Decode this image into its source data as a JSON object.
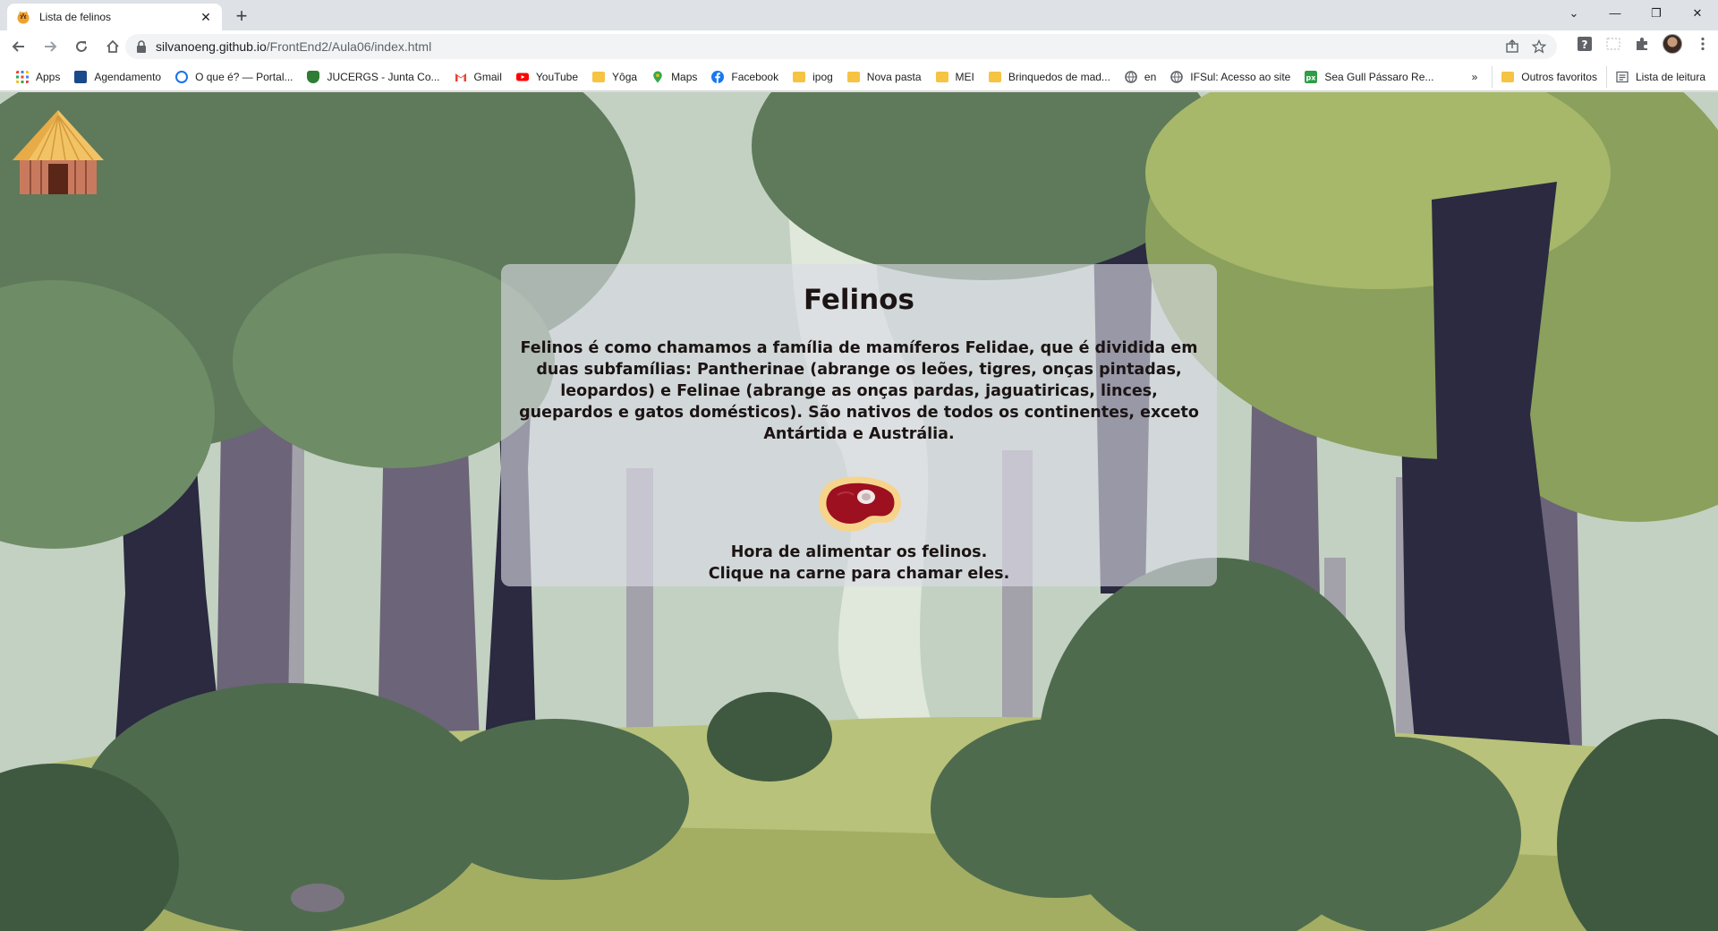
{
  "browser": {
    "tab_title": "Lista de felinos",
    "tab_close": "✕",
    "new_tab": "+",
    "url_host": "silvanoeng.github.io",
    "url_path": "/FrontEnd2/Aula06/index.html",
    "window_controls": [
      "⌄",
      "—",
      "❐",
      "✕"
    ]
  },
  "bookmarks": [
    {
      "label": "Apps",
      "icon": "apps-grid-icon",
      "color": "#ea4335"
    },
    {
      "label": "Agendamento",
      "icon": "agendamento-icon",
      "color": "#1a4a8a"
    },
    {
      "label": "O que é? — Portal...",
      "icon": "portal-icon",
      "color": "#1a73e8"
    },
    {
      "label": "JUCERGS - Junta Co...",
      "icon": "jucergs-icon",
      "color": "#2e7d32"
    },
    {
      "label": "Gmail",
      "icon": "gmail-icon",
      "color": "#ea4335"
    },
    {
      "label": "YouTube",
      "icon": "youtube-icon",
      "color": "#ff0000"
    },
    {
      "label": "Yôga",
      "icon": "folder-icon",
      "color": "#f6c342"
    },
    {
      "label": "Maps",
      "icon": "maps-icon",
      "color": "#34a853"
    },
    {
      "label": "Facebook",
      "icon": "facebook-icon",
      "color": "#1877f2"
    },
    {
      "label": "ipog",
      "icon": "folder-icon",
      "color": "#f6c342"
    },
    {
      "label": "Nova pasta",
      "icon": "folder-icon",
      "color": "#f6c342"
    },
    {
      "label": "MEI",
      "icon": "folder-icon",
      "color": "#f6c342"
    },
    {
      "label": "Brinquedos de mad...",
      "icon": "folder-icon",
      "color": "#f6c342"
    },
    {
      "label": "en",
      "icon": "globe-icon",
      "color": "#5f6368"
    },
    {
      "label": "IFSul: Acesso ao site",
      "icon": "globe-icon",
      "color": "#5f6368"
    },
    {
      "label": "Sea Gull Pássaro Re...",
      "icon": "px-icon",
      "color": "#2e9d48"
    }
  ],
  "bookmarks_right": {
    "overflow": "»",
    "outros": "Outros favoritos",
    "leitura": "Lista de leitura"
  },
  "page": {
    "title": "Felinos",
    "description": "Felinos é como chamamos a família de mamíferos Felidae, que é dividida em duas subfamílias: Pantherinae (abrange os leões, tigres, onças pintadas, leopardos) e Felinae (abrange as onças pardas, jaguatiricas, linces, guepardos e gatos domésticos). São nativos de todos os continentes, exceto Antártida e Austrália.",
    "hint_line1": "Hora de alimentar os felinos.",
    "hint_line2": "Clique na carne para chamar eles."
  }
}
